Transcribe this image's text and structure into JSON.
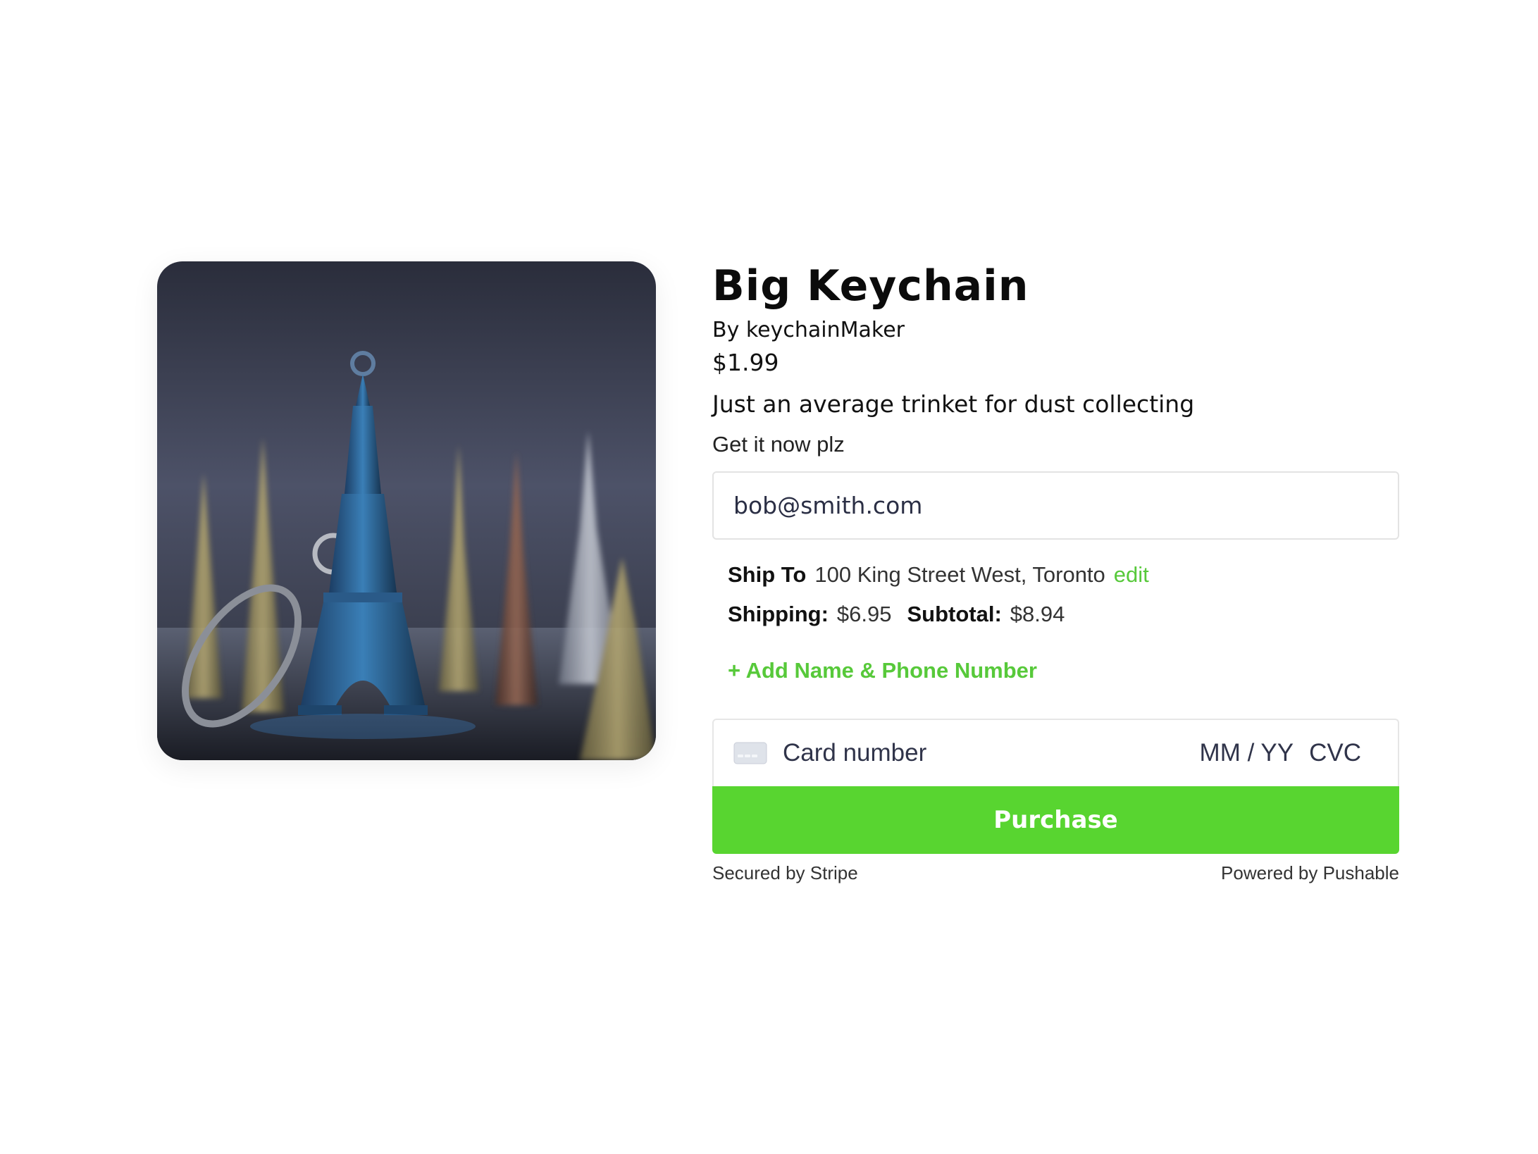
{
  "product": {
    "title": "Big Keychain",
    "byline": "By keychainMaker",
    "price": "$1.99",
    "description": "Just an average trinket for dust collecting",
    "cta": "Get it now plz",
    "image_icon": "eiffel-tower-keychain-photo"
  },
  "checkout": {
    "email_value": "bob@smith.com",
    "ship_to_label": "Ship To",
    "ship_to_address": "100 King Street West, Toronto",
    "edit_label": "edit",
    "shipping_label": "Shipping:",
    "shipping_value": "$6.95",
    "subtotal_label": "Subtotal:",
    "subtotal_value": "$8.94",
    "add_contact_label": "+ Add Name & Phone Number",
    "card_placeholder": "Card number",
    "expiry_placeholder": "MM / YY",
    "cvc_placeholder": "CVC",
    "card_icon": "credit-card-icon",
    "purchase_label": "Purchase"
  },
  "footer": {
    "secured": "Secured by Stripe",
    "powered": "Powered by Pushable"
  },
  "colors": {
    "accent": "#58d530",
    "link": "#57c93a",
    "text": "#111111"
  }
}
